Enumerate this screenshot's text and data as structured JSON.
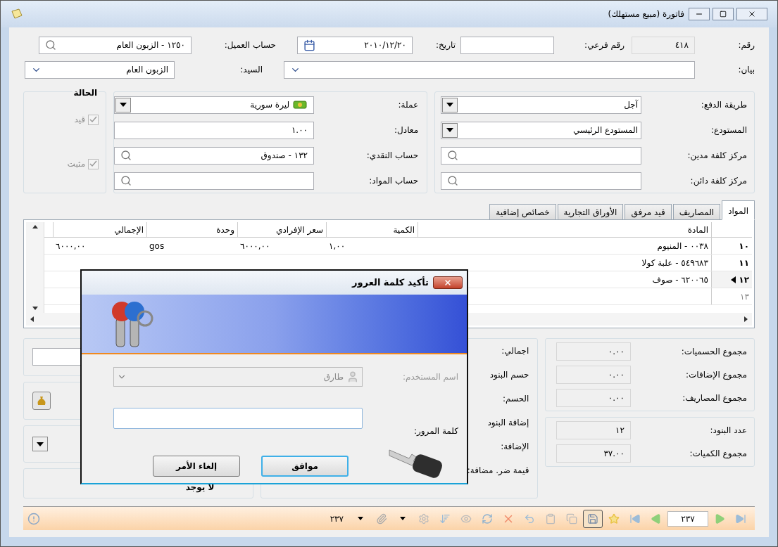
{
  "window": {
    "title": "فاتورة (مبيع مستهلك)"
  },
  "header": {
    "number": {
      "label": "رقم:",
      "value": "٤١٨"
    },
    "sub_number": {
      "label": "رقم فرعي:"
    },
    "date": {
      "label": "تاريخ:",
      "value": "٢٠١٠/١٢/٢٠"
    },
    "customer_account": {
      "label": "حساب العميل:",
      "value": "١٢٥٠ - الزبون العام"
    },
    "statement": {
      "label": "بيان:"
    },
    "mister": {
      "label": "السيد:",
      "value": "الزبون العام"
    }
  },
  "payment_panel": [
    {
      "label": "طريقة الدفع:",
      "value": "آجل",
      "kind": "dropdown"
    },
    {
      "label": "المستودع:",
      "value": "المستودع الرئيسي",
      "kind": "dropdown"
    },
    {
      "label": "مركز كلفة مدين:",
      "kind": "lookup"
    },
    {
      "label": "مركز كلفة دائن:",
      "kind": "lookup"
    }
  ],
  "currency_panel": [
    {
      "label": "عملة:",
      "value": "ليرة سورية",
      "kind": "currency"
    },
    {
      "label": "معادل:",
      "value": "١.٠٠",
      "kind": "text"
    },
    {
      "label": "حساب النقدي:",
      "value": "١٣٢ - صندوق",
      "kind": "lookup"
    },
    {
      "label": "حساب المواد:",
      "kind": "lookup"
    }
  ],
  "status": {
    "title": "الحالة",
    "items": [
      {
        "label": "قيد",
        "checked": true,
        "disabled": true
      },
      {
        "label": "مثبت",
        "checked": true,
        "disabled": true
      }
    ]
  },
  "tabs": [
    {
      "label": "المواد",
      "selected": true
    },
    {
      "label": "المصاريف",
      "selected": false
    },
    {
      "label": "قيد مرفق",
      "selected": false
    },
    {
      "label": "الأوراق التجارية",
      "selected": false
    },
    {
      "label": "خصائص إضافية",
      "selected": false
    }
  ],
  "grid": {
    "columns": [
      "المادة",
      "الكمية",
      "سعر الإفرادي",
      "وحدة",
      "الإجمالي"
    ],
    "rows": [
      {
        "number": "١٠",
        "kind": "item",
        "selected": false,
        "cells": [
          "٠٠٣٨ - المنيوم",
          "١,٠٠",
          "٦٠٠٠,٠٠",
          "gos",
          "٦٠٠٠,٠٠"
        ]
      },
      {
        "number": "١١",
        "kind": "item",
        "selected": false,
        "cells": [
          "٥٤٩٦٨٣ - علبة كولا"
        ]
      },
      {
        "number": "١٢",
        "kind": "item",
        "selected": true,
        "cells": [
          "٦٢٠٠٦٥ - صوف"
        ]
      },
      {
        "number": "١٣",
        "kind": "new",
        "selected": false,
        "cells": []
      }
    ]
  },
  "totals": [
    {
      "label": "مجموع الحسميات:",
      "value": "٠.٠٠"
    },
    {
      "label": "مجموع الإضافات:",
      "value": "٠.٠٠"
    },
    {
      "label": "مجموع المصاريف:",
      "value": "٠.٠٠"
    }
  ],
  "counts": [
    {
      "label": "عدد البنود:",
      "value": "١٢"
    },
    {
      "label": "مجموع الكميات:",
      "value": "٣٧.٠٠"
    }
  ],
  "summary_labels": [
    "اجمالي:",
    "حسم البنود",
    "الحسم:",
    "إضافة البنود",
    "الإضافة:",
    "قيمة ضر. مضافة:"
  ],
  "tax_note": "لا يوجد",
  "toolbar": {
    "record_label": "٢٣٧",
    "record_field": "٢٣٧"
  },
  "dialog": {
    "title": "تأكيد كلمة العرور",
    "user": {
      "label": "اسم المستخدم:",
      "value": "طارق",
      "disabled": true
    },
    "password": {
      "label": "كلمة المرور:"
    },
    "buttons": [
      {
        "label": "موافق",
        "default": true
      },
      {
        "label": "إلغاء الأمر",
        "default": false
      }
    ]
  }
}
